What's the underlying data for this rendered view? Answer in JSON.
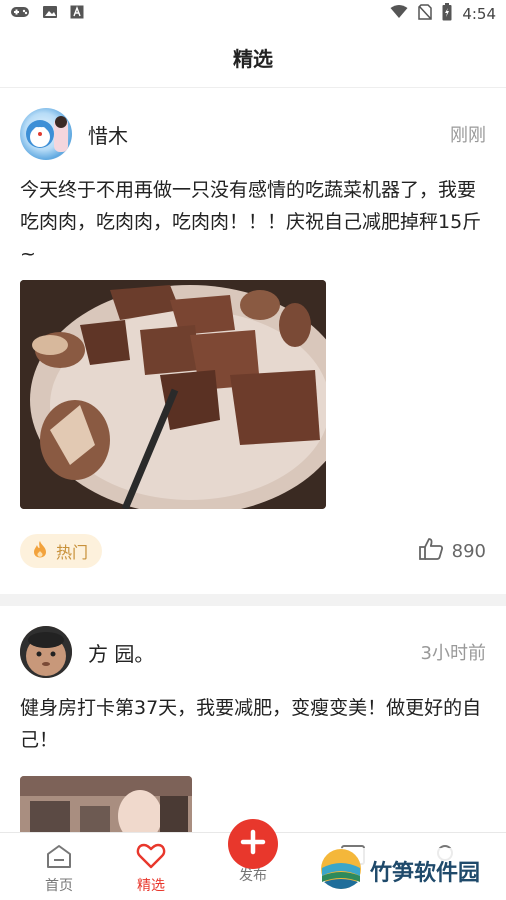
{
  "status_bar": {
    "time": "4:54",
    "left_icons": [
      "gamepad-icon",
      "image-icon",
      "a-notification-icon"
    ],
    "right_icons": [
      "wifi-icon",
      "no-sim-icon",
      "battery-icon"
    ]
  },
  "header": {
    "title": "精选"
  },
  "posts": [
    {
      "username": "惜木",
      "time": "刚刚",
      "text": "今天终于不用再做一只没有感情的吃蔬菜机器了，我要吃肉肉，吃肉肉，吃肉肉！！！庆祝自己减肥掉秤15斤~",
      "image": "grilled-meat-photo",
      "badge": "热门",
      "likes": "890"
    },
    {
      "username": "方 园。",
      "time": "3小时前",
      "text": "健身房打卡第37天，我要减肥，变瘦变美！做更好的自己！",
      "image": "gym-selfie-photo"
    }
  ],
  "bottom_nav": {
    "items": [
      {
        "label": "首页",
        "icon": "home-icon"
      },
      {
        "label": "精选",
        "icon": "heart-icon",
        "active": true
      },
      {
        "label": "发布",
        "icon": "plus-icon"
      },
      {
        "label": "",
        "icon": "message-icon"
      },
      {
        "label": "",
        "icon": "user-icon"
      }
    ]
  },
  "watermark": {
    "text": "竹笋软件园"
  },
  "colors": {
    "accent": "#e8372c",
    "badge_bg": "#fdf1dc",
    "badge_text": "#c8913a",
    "muted": "#999999"
  }
}
